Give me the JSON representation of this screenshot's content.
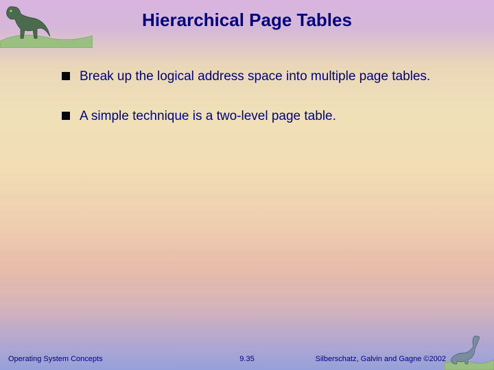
{
  "slide": {
    "title": "Hierarchical Page Tables",
    "bullets": [
      "Break up the logical address space into multiple page tables.",
      "A simple technique is a two-level page table."
    ],
    "footer": {
      "left": "Operating System Concepts",
      "center": "9.35",
      "right": "Silberschatz, Galvin and Gagne ©2002"
    },
    "decorations": {
      "top_left": "dinosaur-trex-icon",
      "bottom_right": "dinosaur-brontosaurus-icon"
    }
  }
}
